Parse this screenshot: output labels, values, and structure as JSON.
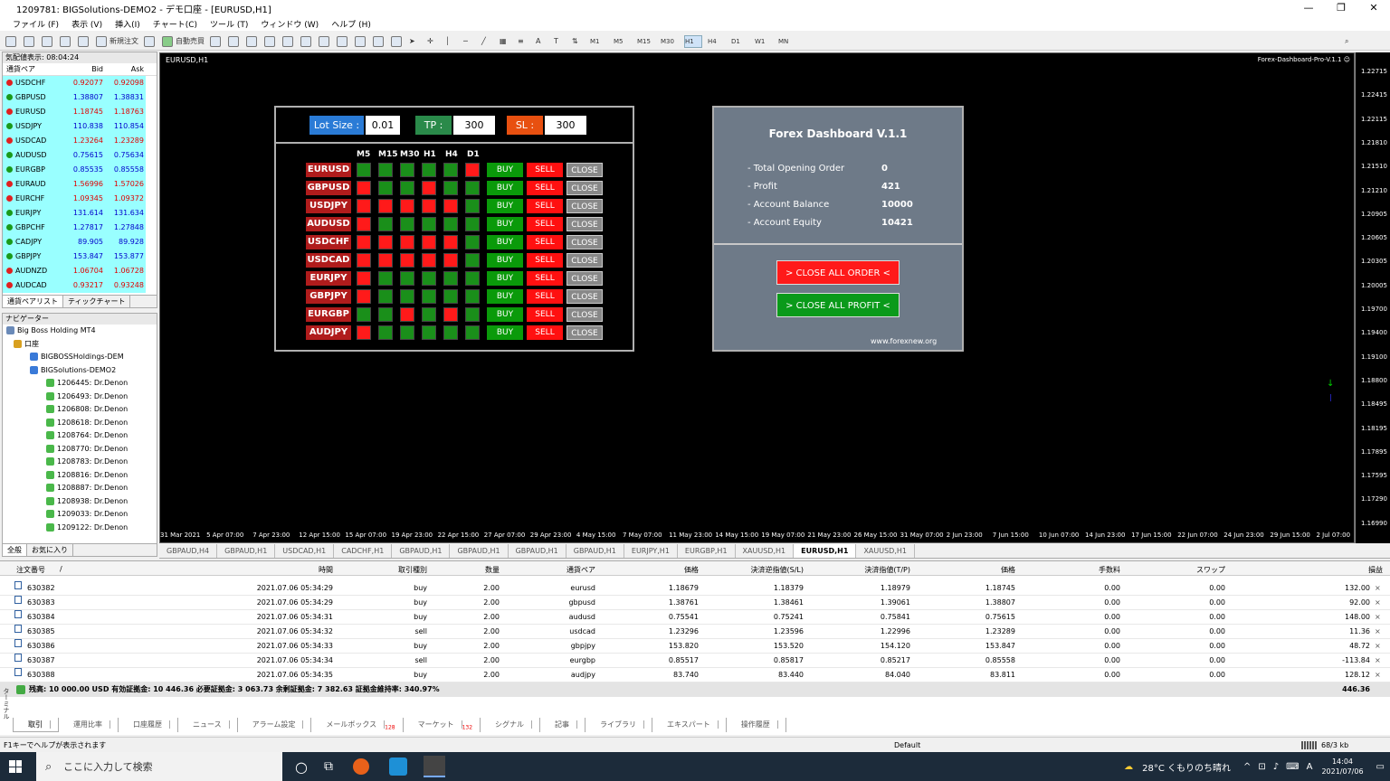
{
  "window": {
    "title": "1209781: BIGSolutions-DEMO2 - デモ口座 - [EURUSD,H1]",
    "min": "—",
    "max": "❐",
    "close": "✕"
  },
  "menu": [
    "ファイル (F)",
    "表示 (V)",
    "挿入(I)",
    "チャート(C)",
    "ツール (T)",
    "ウィンドウ (W)",
    "ヘルプ (H)"
  ],
  "toolbar": {
    "new_order": "新規注文",
    "auto_trading": "自動売買",
    "timeframes": [
      "M1",
      "M5",
      "M15",
      "M30",
      "H1",
      "H4",
      "D1",
      "W1",
      "MN"
    ],
    "active_tf": "H1"
  },
  "market_watch": {
    "header": "気配値表示: 08:04:24",
    "col_symbol": "通貨ペア",
    "col_bid": "Bid",
    "col_ask": "Ask",
    "rows": [
      {
        "s": "USDCHF",
        "b": "0.92077",
        "a": "0.92098",
        "d": "dn"
      },
      {
        "s": "GBPUSD",
        "b": "1.38807",
        "a": "1.38831",
        "d": "up"
      },
      {
        "s": "EURUSD",
        "b": "1.18745",
        "a": "1.18763",
        "d": "dn"
      },
      {
        "s": "USDJPY",
        "b": "110.838",
        "a": "110.854",
        "d": "up"
      },
      {
        "s": "USDCAD",
        "b": "1.23264",
        "a": "1.23289",
        "d": "dn"
      },
      {
        "s": "AUDUSD",
        "b": "0.75615",
        "a": "0.75634",
        "d": "up"
      },
      {
        "s": "EURGBP",
        "b": "0.85535",
        "a": "0.85558",
        "d": "up"
      },
      {
        "s": "EURAUD",
        "b": "1.56996",
        "a": "1.57026",
        "d": "dn"
      },
      {
        "s": "EURCHF",
        "b": "1.09345",
        "a": "1.09372",
        "d": "dn"
      },
      {
        "s": "EURJPY",
        "b": "131.614",
        "a": "131.634",
        "d": "up"
      },
      {
        "s": "GBPCHF",
        "b": "1.27817",
        "a": "1.27848",
        "d": "up"
      },
      {
        "s": "CADJPY",
        "b": "89.905",
        "a": "89.928",
        "d": "up"
      },
      {
        "s": "GBPJPY",
        "b": "153.847",
        "a": "153.877",
        "d": "up"
      },
      {
        "s": "AUDNZD",
        "b": "1.06704",
        "a": "1.06728",
        "d": "dn"
      },
      {
        "s": "AUDCAD",
        "b": "0.93217",
        "a": "0.93248",
        "d": "dn"
      }
    ],
    "tabs": [
      "通貨ペアリスト",
      "ティックチャート"
    ]
  },
  "navigator": {
    "header": "ナビゲーター",
    "items": [
      "Big Boss Holding MT4",
      "口座",
      "BIGBOSSHoldings-DEM",
      "BIGSolutions-DEMO2",
      "1206445: Dr.Denon",
      "1206493: Dr.Denon",
      "1206808: Dr.Denon",
      "1208618: Dr.Denon",
      "1208764: Dr.Denon",
      "1208770: Dr.Denon",
      "1208783: Dr.Denon",
      "1208816: Dr.Denon",
      "1208887: Dr.Denon",
      "1208938: Dr.Denon",
      "1209033: Dr.Denon",
      "1209122: Dr.Denon"
    ],
    "tabs": [
      "全般",
      "お気に入り"
    ]
  },
  "chart": {
    "label": "EURUSD,H1",
    "indicator": "Forex-Dashboard-Pro-V.1.1 ☺",
    "y_labels": [
      "1.22715",
      "1.22415",
      "1.22115",
      "1.21810",
      "1.21510",
      "1.21210",
      "1.20905",
      "1.20605",
      "1.20305",
      "1.20005",
      "1.19700",
      "1.19400",
      "1.19100",
      "1.18800",
      "1.18495",
      "1.18195",
      "1.17895",
      "1.17595",
      "1.17290",
      "1.16990"
    ],
    "x_labels": [
      "31 Mar 2021",
      "5 Apr 07:00",
      "7 Apr 23:00",
      "12 Apr 15:00",
      "15 Apr 07:00",
      "19 Apr 23:00",
      "22 Apr 15:00",
      "27 Apr 07:00",
      "29 Apr 23:00",
      "4 May 15:00",
      "7 May 07:00",
      "11 May 23:00",
      "14 May 15:00",
      "19 May 07:00",
      "21 May 23:00",
      "26 May 15:00",
      "31 May 07:00",
      "2 Jun 23:00",
      "7 Jun 15:00",
      "10 Jun 07:00",
      "14 Jun 23:00",
      "17 Jun 15:00",
      "22 Jun 07:00",
      "24 Jun 23:00",
      "29 Jun 15:00",
      "2 Jul 07:00"
    ]
  },
  "panel1": {
    "lot_label": "Lot Size :",
    "lot_value": "0.01",
    "tp_label": "TP :",
    "tp_value": "300",
    "sl_label": "SL :",
    "sl_value": "300",
    "tfs": [
      "M5",
      "M15",
      "M30",
      "H1",
      "H4",
      "D1"
    ],
    "buy": "BUY",
    "sell": "SELL",
    "close": "CLOSE",
    "rows": [
      {
        "p": "EURUSD",
        "c": [
          "g",
          "g",
          "g",
          "g",
          "g",
          "r"
        ]
      },
      {
        "p": "GBPUSD",
        "c": [
          "r",
          "g",
          "g",
          "r",
          "g",
          "g"
        ]
      },
      {
        "p": "USDJPY",
        "c": [
          "r",
          "r",
          "r",
          "r",
          "r",
          "g"
        ]
      },
      {
        "p": "AUDUSD",
        "c": [
          "r",
          "g",
          "g",
          "g",
          "g",
          "g"
        ]
      },
      {
        "p": "USDCHF",
        "c": [
          "r",
          "r",
          "r",
          "r",
          "r",
          "g"
        ]
      },
      {
        "p": "USDCAD",
        "c": [
          "r",
          "r",
          "r",
          "r",
          "r",
          "g"
        ]
      },
      {
        "p": "EURJPY",
        "c": [
          "r",
          "g",
          "g",
          "g",
          "g",
          "g"
        ]
      },
      {
        "p": "GBPJPY",
        "c": [
          "r",
          "g",
          "g",
          "g",
          "g",
          "g"
        ]
      },
      {
        "p": "EURGBP",
        "c": [
          "g",
          "g",
          "r",
          "g",
          "r",
          "g"
        ]
      },
      {
        "p": "AUDJPY",
        "c": [
          "r",
          "g",
          "g",
          "g",
          "g",
          "g"
        ]
      }
    ]
  },
  "panel2": {
    "title": "Forex Dashboard V.1.1",
    "l1": "- Total Opening Order",
    "v1": "0",
    "l2": "- Profit",
    "v2": "421",
    "l3": "- Account Balance",
    "v3": "10000",
    "l4": "- Account Equity",
    "v4": "10421",
    "btn1": "> CLOSE ALL ORDER <",
    "btn2": "> CLOSE ALL PROFIT <",
    "site": "www.forexnew.org"
  },
  "chart_tabs": [
    "GBPAUD,H4",
    "GBPAUD,H1",
    "USDCAD,H1",
    "CADCHF,H1",
    "GBPAUD,H1",
    "GBPAUD,H1",
    "GBPAUD,H1",
    "GBPAUD,H1",
    "EURJPY,H1",
    "EURGBP,H1",
    "XAUUSD,H1",
    "EURUSD,H1",
    "XAUUSD,H1"
  ],
  "active_chart_tab": "EURUSD,H1",
  "terminal": {
    "headers": [
      "注文番号",
      "/",
      "時間",
      "取引種別",
      "数量",
      "通貨ペア",
      "価格",
      "決済逆指値(S/L)",
      "決済指値(T/P)",
      "価格",
      "手数料",
      "スワップ",
      "損益"
    ],
    "rows": [
      [
        "630382",
        "2021.07.06 05:34:29",
        "buy",
        "2.00",
        "eurusd",
        "1.18679",
        "1.18379",
        "1.18979",
        "1.18745",
        "0.00",
        "0.00",
        "132.00"
      ],
      [
        "630383",
        "2021.07.06 05:34:29",
        "buy",
        "2.00",
        "gbpusd",
        "1.38761",
        "1.38461",
        "1.39061",
        "1.38807",
        "0.00",
        "0.00",
        "92.00"
      ],
      [
        "630384",
        "2021.07.06 05:34:31",
        "buy",
        "2.00",
        "audusd",
        "0.75541",
        "0.75241",
        "0.75841",
        "0.75615",
        "0.00",
        "0.00",
        "148.00"
      ],
      [
        "630385",
        "2021.07.06 05:34:32",
        "sell",
        "2.00",
        "usdcad",
        "1.23296",
        "1.23596",
        "1.22996",
        "1.23289",
        "0.00",
        "0.00",
        "11.36"
      ],
      [
        "630386",
        "2021.07.06 05:34:33",
        "buy",
        "2.00",
        "gbpjpy",
        "153.820",
        "153.520",
        "154.120",
        "153.847",
        "0.00",
        "0.00",
        "48.72"
      ],
      [
        "630387",
        "2021.07.06 05:34:34",
        "sell",
        "2.00",
        "eurgbp",
        "0.85517",
        "0.85817",
        "0.85217",
        "0.85558",
        "0.00",
        "0.00",
        "-113.84"
      ],
      [
        "630388",
        "2021.07.06 05:34:35",
        "buy",
        "2.00",
        "audjpy",
        "83.740",
        "83.440",
        "84.040",
        "83.811",
        "0.00",
        "0.00",
        "128.12"
      ]
    ],
    "balance": "残高: 10 000.00 USD  有効証拠金: 10 446.36  必要証拠金: 3 063.73  余剰証拠金: 7 382.63  証拠金維持率: 340.97%",
    "total": "446.36",
    "tabs": [
      "取引",
      "運用比率",
      "口座履歴",
      "ニュース",
      "アラーム設定",
      "メールボックス",
      "マーケット",
      "シグナル",
      "記事",
      "ライブラリ",
      "エキスパート",
      "操作履歴"
    ],
    "mail_count": "128",
    "market_count": "132",
    "side_label": "ターミナル"
  },
  "status": {
    "help": "F1キーでヘルプが表示されます",
    "profile": "Default",
    "traffic": "68/3 kb"
  },
  "taskbar": {
    "search": "ここに入力して検索",
    "weather": "28°C くもりのち晴れ",
    "time": "14:04",
    "date": "2021/07/06",
    "ime": "A"
  }
}
